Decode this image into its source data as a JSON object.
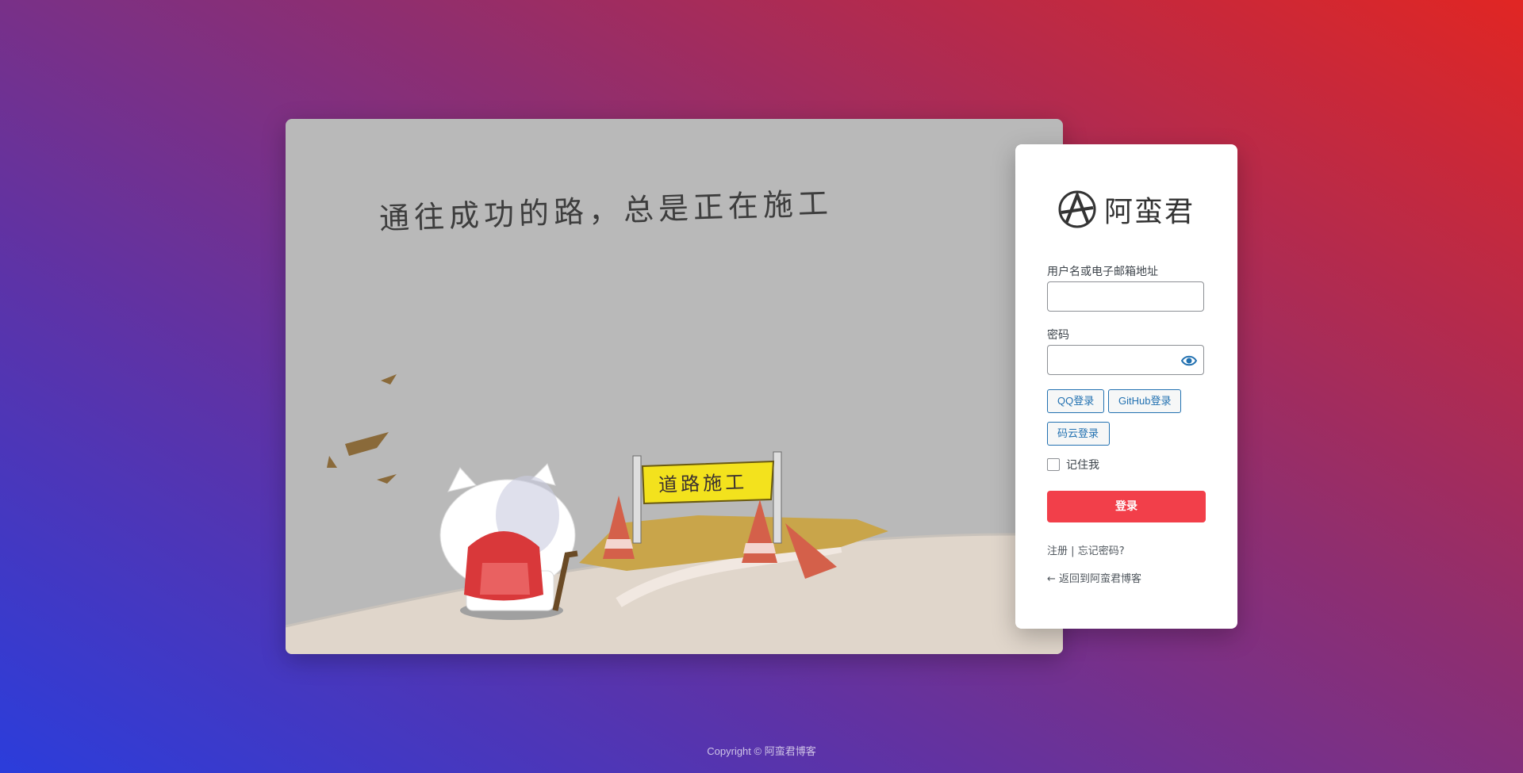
{
  "illustration": {
    "slogan": "通往成功的路，总是正在施工",
    "sign_text": "道路施工"
  },
  "brand": {
    "name": "阿蛮君"
  },
  "form": {
    "username_label": "用户名或电子邮箱地址",
    "username_value": "",
    "password_label": "密码",
    "password_value": "",
    "oauth": [
      "QQ登录",
      "GitHub登录",
      "码云登录"
    ],
    "remember_label": "记住我",
    "submit_label": "登录"
  },
  "links": {
    "register": "注册",
    "separator": "|",
    "forgot": "忘记密码?",
    "back": "← 返回到阿蛮君博客"
  },
  "footer": {
    "text": "Copyright © 阿蛮君博客"
  },
  "colors": {
    "accent": "#f23f4a",
    "link": "#2271b1"
  }
}
